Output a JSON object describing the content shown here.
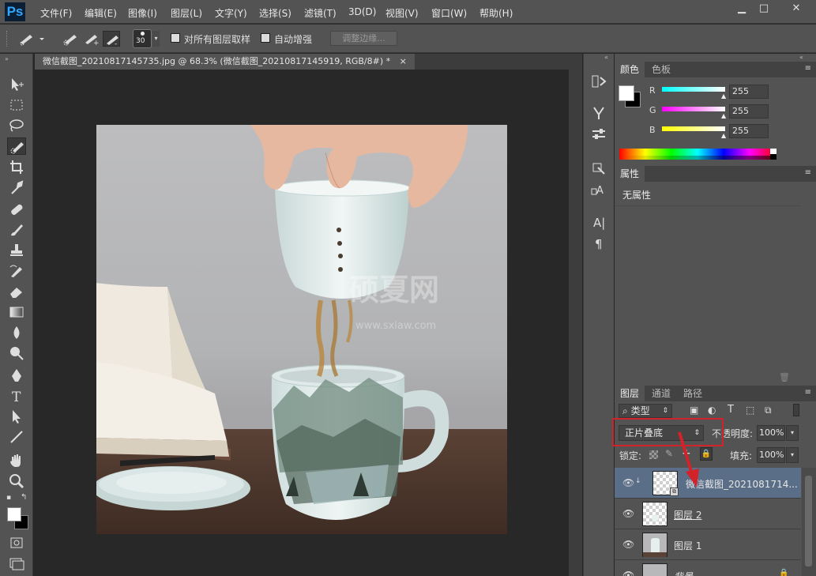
{
  "app": {
    "logo": "Ps"
  },
  "menu": [
    "文件(F)",
    "编辑(E)",
    "图像(I)",
    "图层(L)",
    "文字(Y)",
    "选择(S)",
    "滤镜(T)",
    "3D(D)",
    "视图(V)",
    "窗口(W)",
    "帮助(H)"
  ],
  "window_controls": {
    "minimize": "▁",
    "maximize": "□",
    "close": "✕"
  },
  "options": {
    "brush_size": "30",
    "sample_all_layers": "对所有图层取样",
    "auto_enhance": "自动增强",
    "refine_edge": "调整边缘..."
  },
  "document": {
    "tab_title": "微信截图_20210817145735.jpg @ 68.3% (微信截图_20210817145919, RGB/8#) *",
    "tab_close": "×",
    "watermark_cn": "硕夏网",
    "watermark_url": "www.sxiaw.com"
  },
  "color_panel": {
    "tabs": [
      "颜色",
      "色板"
    ],
    "channels": [
      {
        "label": "R",
        "value": "255"
      },
      {
        "label": "G",
        "value": "255"
      },
      {
        "label": "B",
        "value": "255"
      }
    ]
  },
  "properties_panel": {
    "tab": "属性",
    "content": "无属性"
  },
  "layers_panel": {
    "tabs": [
      "图层",
      "通道",
      "路径"
    ],
    "filter_kind": "类型",
    "blend_mode": "正片叠底",
    "opacity_label": "不透明度:",
    "opacity_value": "100%",
    "lock_label": "锁定:",
    "fill_label": "填充:",
    "fill_value": "100%",
    "layers": [
      {
        "name": "微信截图_2021081714...",
        "selected": true
      },
      {
        "name": "图层 2"
      },
      {
        "name": "图层 1"
      },
      {
        "name": "背景"
      }
    ]
  },
  "colors": {
    "highlight": "#d2232a",
    "selected_layer": "#5a6e88"
  }
}
